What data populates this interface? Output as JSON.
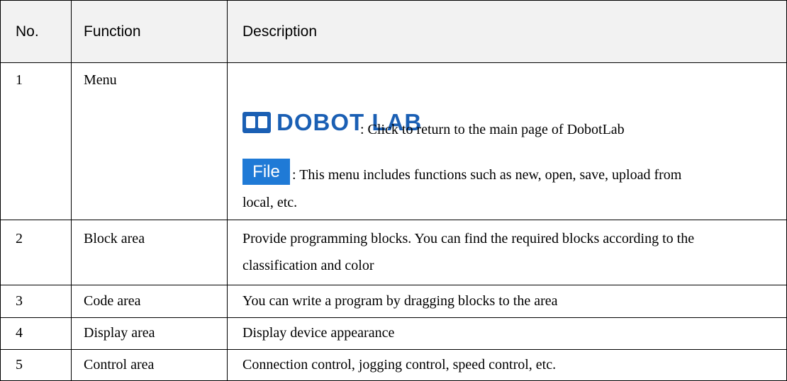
{
  "headers": [
    "No.",
    "Function",
    "Description"
  ],
  "rows": [
    {
      "no": "1",
      "function": "Menu",
      "logo_text": "DOBOT LAB",
      "logo_desc": ": Click to return to the main page of DobotLab",
      "file_label": "File",
      "file_desc_line1": ": This menu includes functions such as new, open, save, upload from",
      "file_desc_line2": "local, etc."
    },
    {
      "no": "2",
      "function": "Block area",
      "desc_line1": "Provide programming blocks. You can find the required blocks according to the",
      "desc_line2": "classification and color"
    },
    {
      "no": "3",
      "function": "Code area",
      "desc_line1": "You can write a program by dragging blocks to the area"
    },
    {
      "no": "4",
      "function": "Display area",
      "desc_line1": "Display device appearance"
    },
    {
      "no": "5",
      "function": "Control area",
      "desc_line1": "Connection control, jogging control, speed control, etc."
    }
  ],
  "colors": {
    "header_bg": "#f2f2f2",
    "logo_blue": "#1a5fb4",
    "file_button_blue": "#1f7ad6"
  },
  "icons": {
    "logo": "book-icon"
  }
}
